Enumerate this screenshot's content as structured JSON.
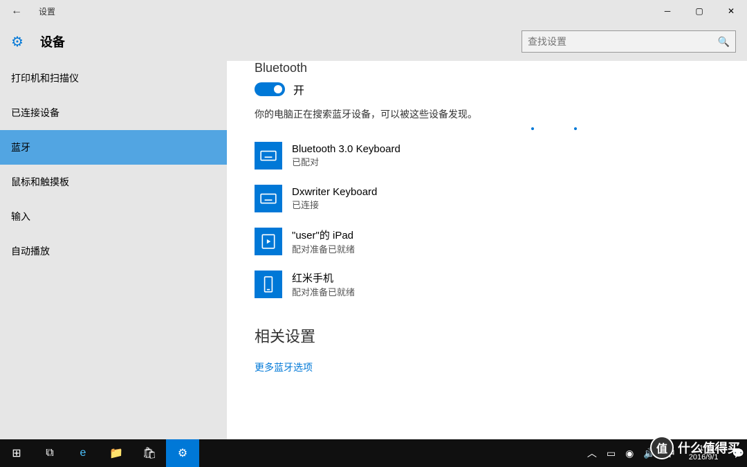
{
  "titlebar": {
    "back": "←",
    "title": "设置"
  },
  "header": {
    "label": "设备",
    "search_placeholder": "查找设置"
  },
  "sidebar": {
    "items": [
      {
        "label": "打印机和扫描仪"
      },
      {
        "label": "已连接设备"
      },
      {
        "label": "蓝牙"
      },
      {
        "label": "鼠标和触摸板"
      },
      {
        "label": "输入"
      },
      {
        "label": "自动播放"
      }
    ]
  },
  "content": {
    "section_title": "Bluetooth",
    "toggle_state": "开",
    "desc": "你的电脑正在搜索蓝牙设备，可以被这些设备发现。",
    "devices": [
      {
        "name": "Bluetooth 3.0 Keyboard",
        "status": "已配对",
        "icon": "keyboard"
      },
      {
        "name": "Dxwriter Keyboard",
        "status": "已连接",
        "icon": "keyboard"
      },
      {
        "name": "\"user\"的 iPad",
        "status": "配对准备已就绪",
        "icon": "tablet"
      },
      {
        "name": "红米手机",
        "status": "配对准备已就绪",
        "icon": "phone"
      }
    ],
    "related_title": "相关设置",
    "related_link": "更多蓝牙选项"
  },
  "taskbar": {
    "time": "17:52",
    "date": "2016/9/1"
  },
  "watermark": "什么值得买"
}
